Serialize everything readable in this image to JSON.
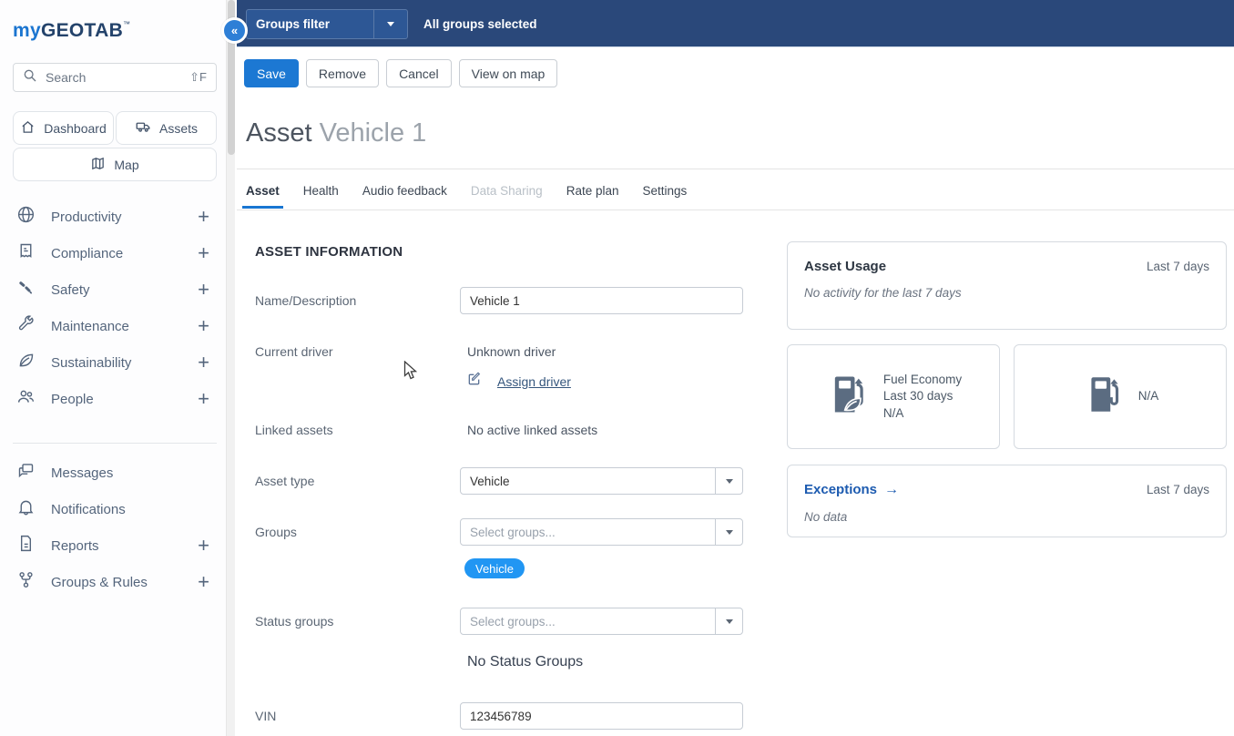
{
  "colors": {
    "navy": "#2a487a",
    "accent_blue": "#1c78d3",
    "chip_blue": "#2196f3",
    "tab_underline": "#1976d2",
    "link_blue": "#1d5bb0"
  },
  "sidebar": {
    "logo": {
      "my": "my",
      "geotab": "GEOTAB",
      "tm": "™"
    },
    "search": {
      "placeholder": "Search",
      "shortcut": "⇧F"
    },
    "quick_nav": [
      {
        "label": "Dashboard"
      },
      {
        "label": "Assets"
      },
      {
        "label": "Map"
      }
    ],
    "menu": [
      {
        "label": "Productivity",
        "plus": "+"
      },
      {
        "label": "Compliance",
        "plus": "+"
      },
      {
        "label": "Safety",
        "plus": "+"
      },
      {
        "label": "Maintenance",
        "plus": "+"
      },
      {
        "label": "Sustainability",
        "plus": "+"
      },
      {
        "label": "People",
        "plus": "+"
      }
    ],
    "menu_secondary": [
      {
        "label": "Messages",
        "plus": ""
      },
      {
        "label": "Notifications",
        "plus": ""
      },
      {
        "label": "Reports",
        "plus": "+"
      },
      {
        "label": "Groups & Rules",
        "plus": "+"
      }
    ],
    "collapse_glyph": "«"
  },
  "topbar": {
    "groups_filter_label": "Groups filter",
    "selection_text": "All groups selected"
  },
  "actions": {
    "save": "Save",
    "remove": "Remove",
    "cancel": "Cancel",
    "view_on_map": "View on map"
  },
  "page": {
    "title_prefix": "Asset",
    "title_name": "Vehicle 1"
  },
  "tabs": [
    {
      "label": "Asset",
      "state": "active"
    },
    {
      "label": "Health",
      "state": "normal"
    },
    {
      "label": "Audio feedback",
      "state": "normal"
    },
    {
      "label": "Data Sharing",
      "state": "disabled"
    },
    {
      "label": "Rate plan",
      "state": "normal"
    },
    {
      "label": "Settings",
      "state": "normal"
    }
  ],
  "form": {
    "section_title": "ASSET INFORMATION",
    "name_label": "Name/Description",
    "name_value": "Vehicle 1",
    "current_driver_label": "Current driver",
    "current_driver_value": "Unknown driver",
    "assign_driver_label": "Assign driver",
    "linked_assets_label": "Linked assets",
    "linked_assets_value": "No active linked assets",
    "asset_type_label": "Asset type",
    "asset_type_value": "Vehicle",
    "groups_label": "Groups",
    "groups_placeholder": "Select groups...",
    "groups_chip": "Vehicle",
    "status_groups_label": "Status groups",
    "status_groups_placeholder": "Select groups...",
    "status_groups_empty": "No Status Groups",
    "vin_label": "VIN",
    "vin_value": "123456789"
  },
  "cards": {
    "asset_usage": {
      "title": "Asset Usage",
      "period": "Last 7 days",
      "empty_text": "No activity for the last 7 days"
    },
    "fuel_economy": {
      "line1": "Fuel Economy",
      "line2": "Last 30 days",
      "line3": "N/A"
    },
    "fuel_secondary": {
      "value": "N/A"
    },
    "exceptions": {
      "title": "Exceptions",
      "arrow": "→",
      "period": "Last 7 days",
      "empty_text": "No data"
    }
  }
}
